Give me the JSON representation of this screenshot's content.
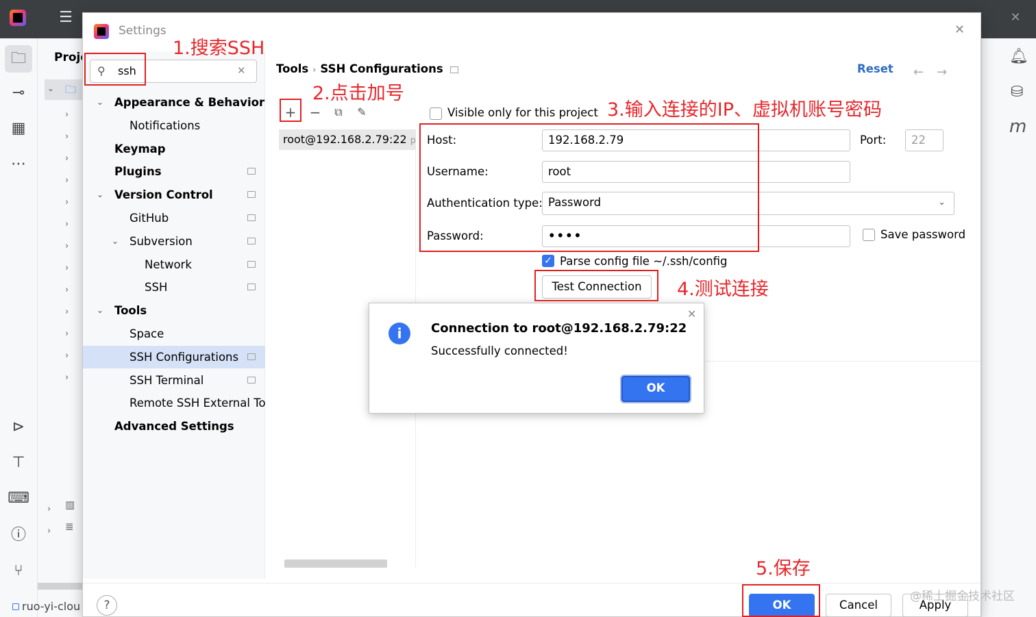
{
  "window": {
    "dialog_title": "Settings",
    "project_panel_label": "Proje",
    "status_project": "ruo-yi-clou"
  },
  "search": {
    "value": "ssh",
    "placeholder": ""
  },
  "nav": {
    "items": [
      {
        "label": "Appearance & Behavior",
        "level": 0,
        "bold": true,
        "expanded": true,
        "badge": false
      },
      {
        "label": "Notifications",
        "level": 1,
        "bold": false,
        "badge": false
      },
      {
        "label": "Keymap",
        "level": 0,
        "bold": true,
        "badge": false
      },
      {
        "label": "Plugins",
        "level": 0,
        "bold": true,
        "badge": true
      },
      {
        "label": "Version Control",
        "level": 0,
        "bold": true,
        "expanded": true,
        "badge": true
      },
      {
        "label": "GitHub",
        "level": 1,
        "bold": false,
        "badge": true
      },
      {
        "label": "Subversion",
        "level": 1,
        "bold": false,
        "expanded": true,
        "badge": true
      },
      {
        "label": "Network",
        "level": 2,
        "bold": false,
        "badge": true
      },
      {
        "label": "SSH",
        "level": 2,
        "bold": false,
        "badge": true
      },
      {
        "label": "Tools",
        "level": 0,
        "bold": true,
        "expanded": true,
        "badge": false
      },
      {
        "label": "Space",
        "level": 1,
        "bold": false,
        "badge": false
      },
      {
        "label": "SSH Configurations",
        "level": 1,
        "bold": false,
        "badge": true,
        "selected": true
      },
      {
        "label": "SSH Terminal",
        "level": 1,
        "bold": false,
        "badge": true
      },
      {
        "label": "Remote SSH External To",
        "level": 1,
        "bold": false,
        "badge": false
      },
      {
        "label": "Advanced Settings",
        "level": 0,
        "bold": true,
        "badge": false
      }
    ]
  },
  "breadcrumb": {
    "parent": "Tools",
    "current": "SSH Configurations"
  },
  "header_actions": {
    "reset": "Reset"
  },
  "config_list": {
    "item": "root@192.168.2.79:22",
    "item_hint": "pas"
  },
  "form": {
    "visible_only_label": "Visible only for this project",
    "visible_only_checked": false,
    "host_label": "Host:",
    "host_value": "192.168.2.79",
    "port_label": "Port:",
    "port_value": "22",
    "username_label": "Username:",
    "username_value": "root",
    "auth_label": "Authentication type:",
    "auth_value": "Password",
    "password_label": "Password:",
    "password_value": "••••",
    "save_password_label": "Save password",
    "save_password_checked": false,
    "parse_config_label": "Parse config file ~/.ssh/config",
    "parse_config_checked": true,
    "test_connection": "Test Connection"
  },
  "popup": {
    "title": "Connection to root@192.168.2.79:22",
    "message": "Successfully connected!",
    "ok": "OK"
  },
  "footer": {
    "ok": "OK",
    "cancel": "Cancel",
    "apply": "Apply",
    "help": "?"
  },
  "annotations": {
    "step1": "1.搜索SSH",
    "step2": "2.点击加号",
    "step3": "3.输入连接的IP、虚拟机账号密码",
    "step4": "4.测试连接",
    "step5": "5.保存"
  },
  "watermark": "@稀土掘金技术社区",
  "colors": {
    "accent": "#3574f0",
    "annotation": "#e02020",
    "link": "#2f6bc2"
  }
}
